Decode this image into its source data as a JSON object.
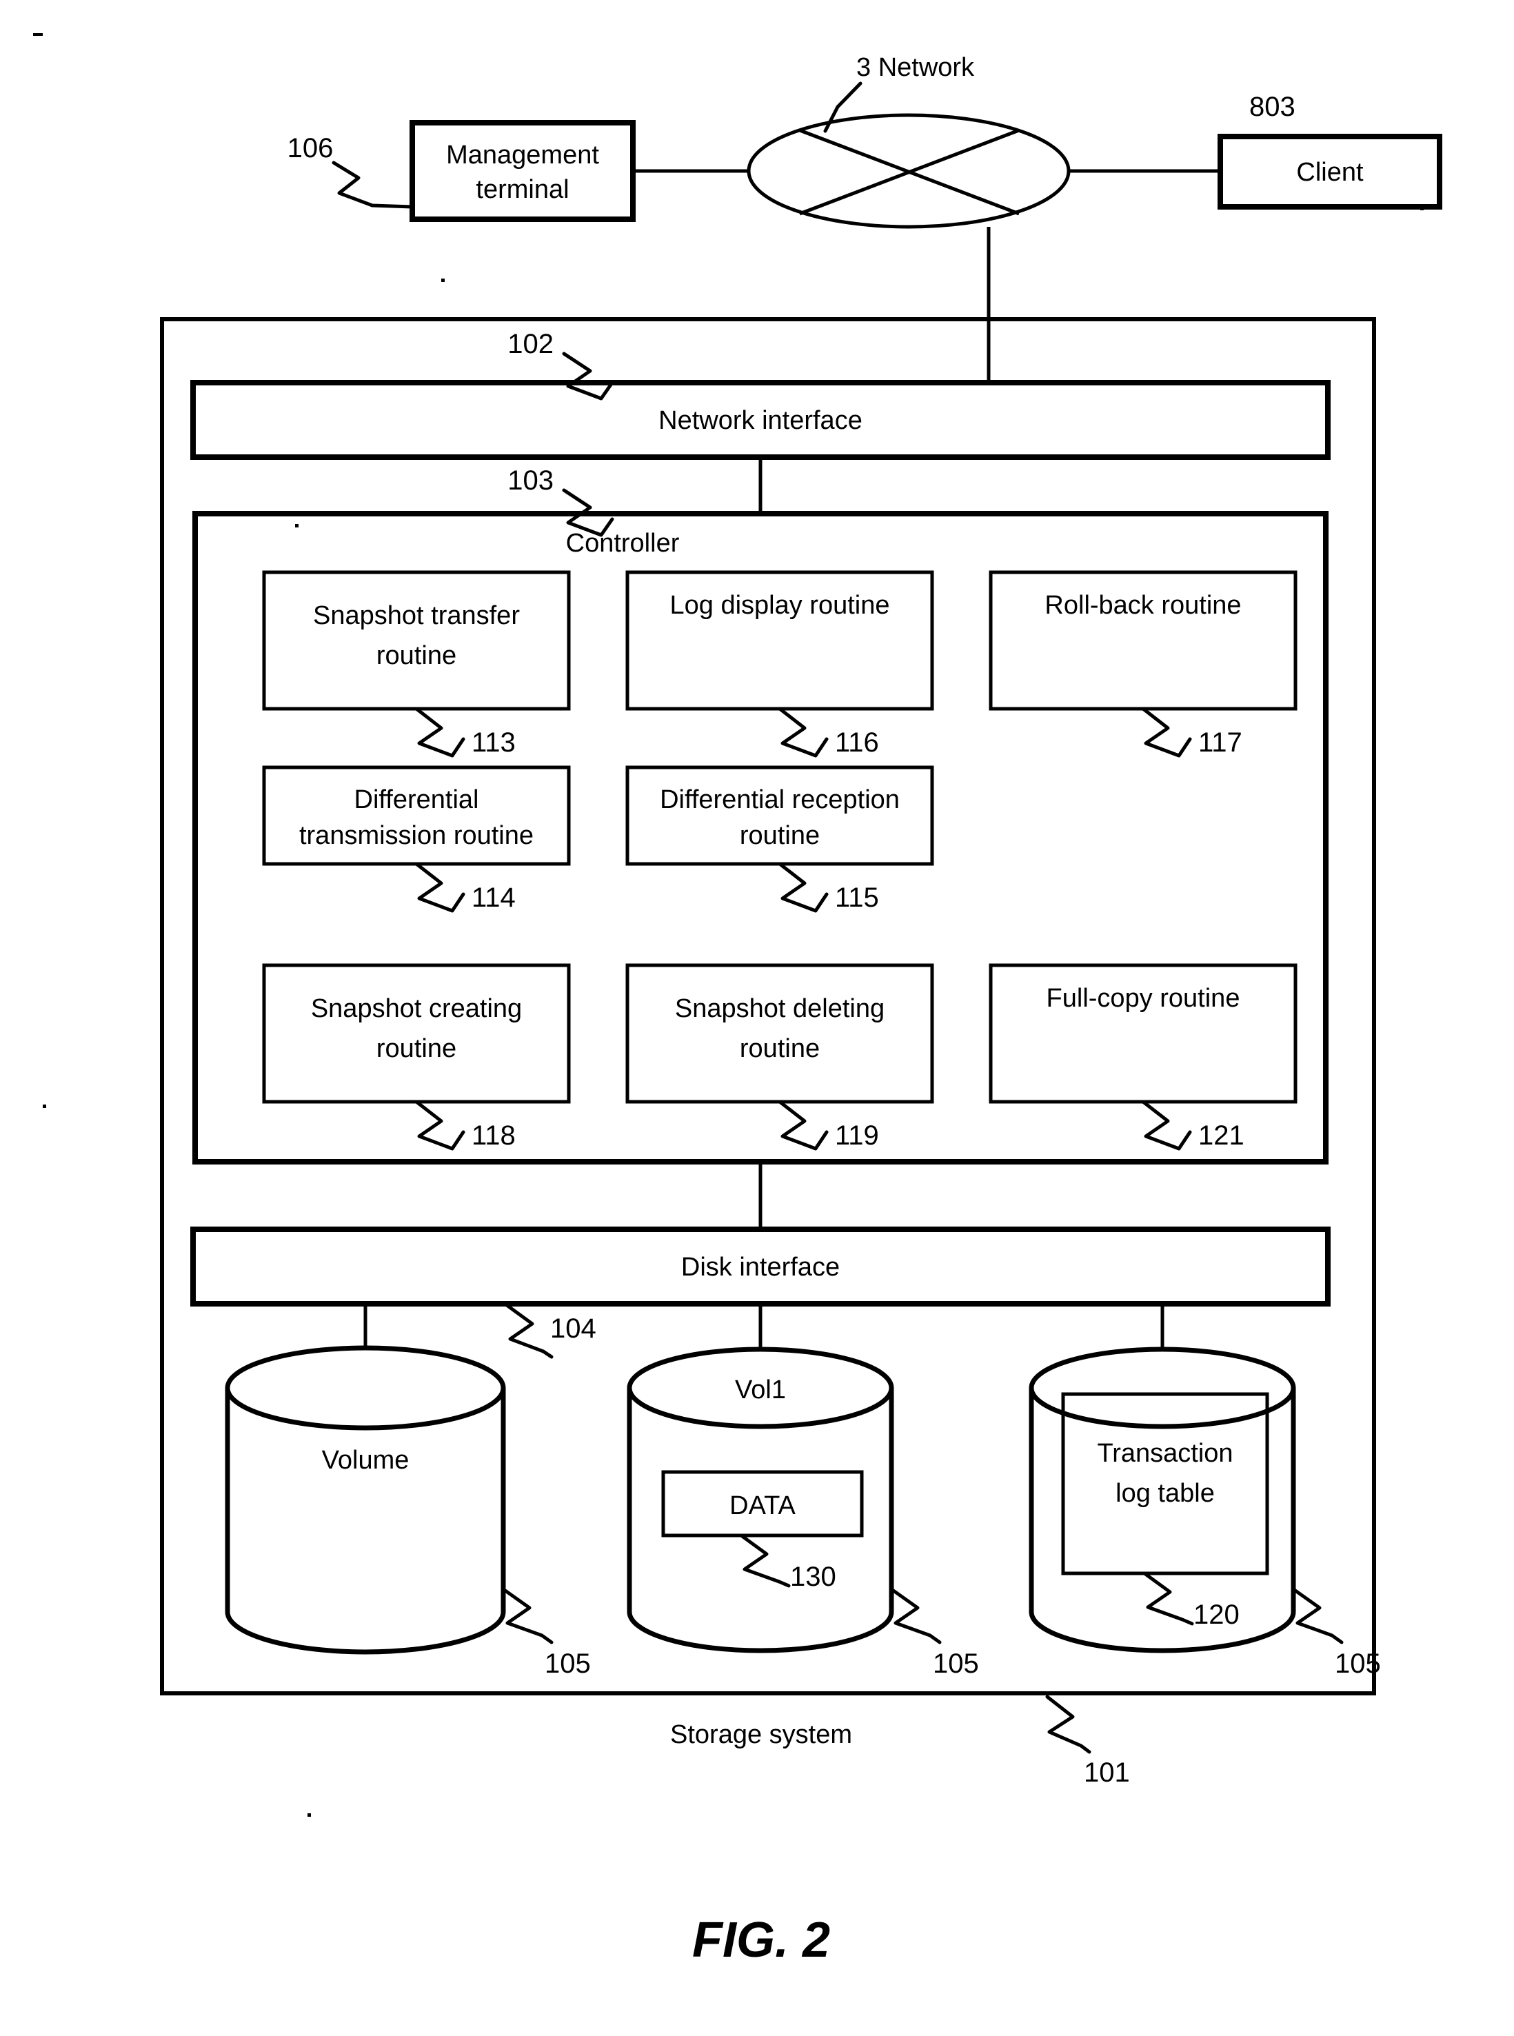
{
  "figure": {
    "caption": "FIG. 2",
    "title_top": "3 Network"
  },
  "top_row": {
    "management_terminal": {
      "label_line1": "Management",
      "label_line2": "terminal",
      "ref": "106"
    },
    "network": {
      "label": "3 Network"
    },
    "client": {
      "label": "Client",
      "ref": "803"
    }
  },
  "storage_system": {
    "label": "Storage system",
    "ref": "101",
    "network_interface": {
      "label": "Network interface",
      "ref": "102"
    },
    "controller": {
      "label": "Controller",
      "ref": "103",
      "routines": [
        {
          "line1": "Snapshot transfer",
          "line2": "routine",
          "ref": "113"
        },
        {
          "line1": "Log display routine",
          "line2": "",
          "ref": "116"
        },
        {
          "line1": "Roll-back routine",
          "line2": "",
          "ref": "117"
        },
        {
          "line1": "Differential",
          "line2": "transmission routine",
          "ref": "114"
        },
        {
          "line1": "Differential reception",
          "line2": "routine",
          "ref": "115"
        },
        {
          "line1": "Snapshot creating",
          "line2": "routine",
          "ref": "118"
        },
        {
          "line1": "Snapshot deleting",
          "line2": "routine",
          "ref": "119"
        },
        {
          "line1": "Full-copy routine",
          "line2": "",
          "ref": "121"
        }
      ]
    },
    "disk_interface": {
      "label": "Disk interface",
      "ref": "104"
    },
    "volumes": [
      {
        "top_label": "",
        "body_label": "Volume",
        "inner_box": "",
        "inner_ref": "",
        "ref": "105"
      },
      {
        "top_label": "Vol1",
        "body_label": "",
        "inner_box": "DATA",
        "inner_ref": "130",
        "ref": "105"
      },
      {
        "top_label": "",
        "body_label": "",
        "inner_box_line1": "Transaction",
        "inner_box_line2": "log table",
        "inner_ref": "120",
        "ref": "105"
      }
    ]
  },
  "colors": {
    "line": "#000000",
    "background": "#ffffff"
  }
}
